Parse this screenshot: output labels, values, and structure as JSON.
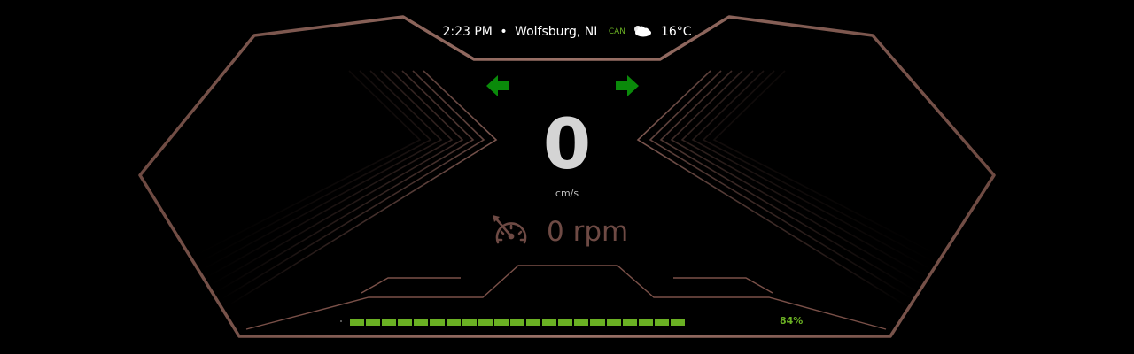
{
  "status_bar": {
    "time": "2:23 PM",
    "separator": "•",
    "location": "Wolfsburg, NI",
    "connection_label": "CAN",
    "weather_icon": "cloud-sun-icon",
    "temperature": "16°C"
  },
  "turn_signals": {
    "left_icon": "arrow-left-icon",
    "right_icon": "arrow-right-icon",
    "color": "#0a8a0a"
  },
  "speed": {
    "value": "0",
    "unit": "cm/s"
  },
  "rpm": {
    "icon": "speedometer-icon",
    "value": "0 rpm"
  },
  "battery": {
    "percent_label": "84%",
    "level": 0.84,
    "segment_count": 21,
    "color": "#6ab023"
  },
  "colors": {
    "frame": "#8a6058",
    "background": "#000000",
    "accent": "#6ab023"
  }
}
